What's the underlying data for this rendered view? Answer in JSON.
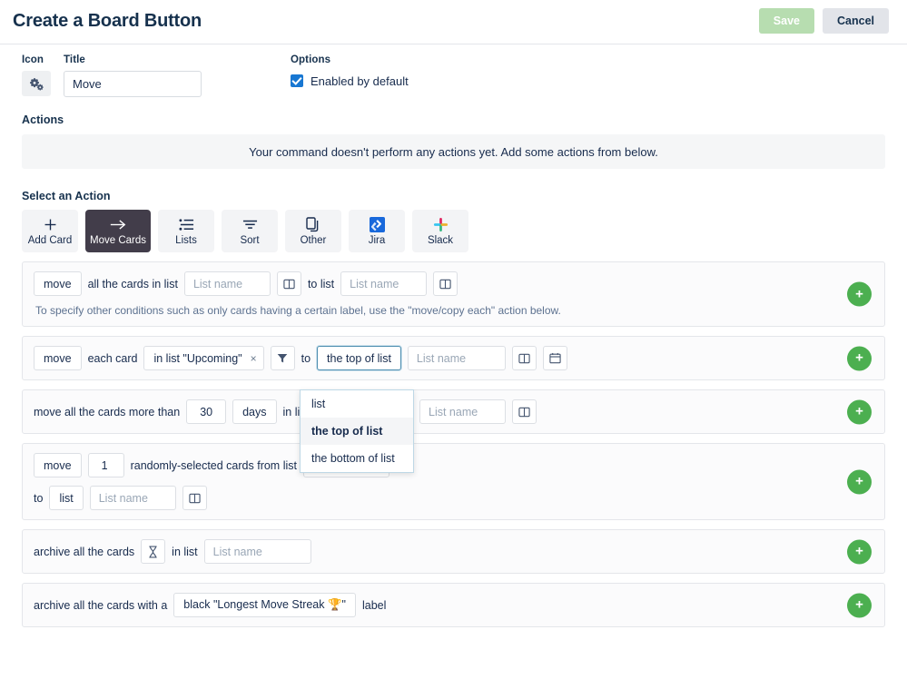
{
  "header": {
    "title": "Create a Board Button",
    "save_label": "Save",
    "cancel_label": "Cancel",
    "save_color": "#b7ddb0",
    "cancel_color": "#e2e4e9"
  },
  "form": {
    "icon_label": "Icon",
    "icon_name": "cogs-icon",
    "title_label": "Title",
    "title_value": "Move",
    "options_label": "Options",
    "enabled_label": "Enabled by default",
    "enabled_checked": true,
    "checkbox_color": "#1877d2"
  },
  "actions_section": {
    "heading": "Actions",
    "empty_message": "Your command doesn't perform any actions yet. Add some actions from below."
  },
  "select_action": {
    "heading": "Select an Action",
    "tabs": [
      {
        "label": "Add Card",
        "icon": "plus-icon",
        "active": false
      },
      {
        "label": "Move Cards",
        "icon": "arrow-right-icon",
        "active": true
      },
      {
        "label": "Lists",
        "icon": "list-icon",
        "active": false
      },
      {
        "label": "Sort",
        "icon": "sort-icon",
        "active": false
      },
      {
        "label": "Other",
        "icon": "copy-icon",
        "active": false
      },
      {
        "label": "Jira",
        "icon": "jira-icon",
        "active": false
      },
      {
        "label": "Slack",
        "icon": "slack-icon",
        "active": false
      }
    ]
  },
  "action_rows": {
    "row1": {
      "verb": "move",
      "text1": "all the cards in list",
      "list_placeholder": "List name",
      "text2": "to list",
      "list2_placeholder": "List name",
      "hint": "To specify other conditions such as only cards having a certain label, use the \"move/copy each\" action below.",
      "add_label": "+"
    },
    "row2": {
      "verb": "move",
      "text1": "each card",
      "filter_tag": "in list \"Upcoming\"",
      "tag_remove": "×",
      "text2": "to",
      "position_value": "the top of list",
      "list_placeholder": "List name",
      "add_label": "+"
    },
    "row3": {
      "text1": "move all the cards more than",
      "days_value": "30",
      "unit_value": "days",
      "text2": "in list",
      "list_placeholder": "List name",
      "add_label": "+"
    },
    "row4": {
      "verb": "move",
      "count_value": "1",
      "text1": "randomly-selected cards from list",
      "list_placeholder": "List name",
      "text2": "to",
      "position_value": "list",
      "list2_placeholder": "List name",
      "add_label": "+"
    },
    "row5": {
      "text1": "archive all the cards",
      "timing_icon": "hourglass-icon",
      "text2": "in list",
      "list_placeholder": "List name",
      "add_label": "+"
    },
    "row6": {
      "text1": "archive all the cards with a",
      "label_value": "black \"Longest Move Streak 🏆\"",
      "text2": "label",
      "add_label": "+"
    }
  },
  "dropdown": {
    "open": true,
    "items": [
      {
        "label": "list",
        "selected": false
      },
      {
        "label": "the top of list",
        "selected": true
      },
      {
        "label": "the bottom of list",
        "selected": false
      }
    ]
  }
}
